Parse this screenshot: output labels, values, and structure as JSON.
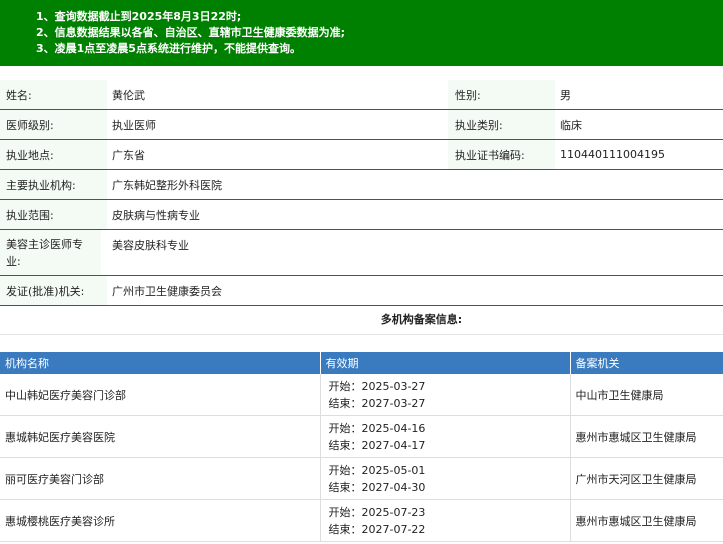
{
  "notice": [
    "1、查询数据截止到2025年8月3日22时;",
    "2、信息数据结果以各省、自治区、直辖市卫生健康委数据为准;",
    "3、凌晨1点至凌晨5点系统进行维护，不能提供查询。"
  ],
  "info": {
    "name_label": "姓名:",
    "name": "黄伦武",
    "gender_label": "性别:",
    "gender": "男",
    "level_label": "医师级别:",
    "level": "执业医师",
    "category_label": "执业类别:",
    "category": "临床",
    "location_label": "执业地点:",
    "location": "广东省",
    "cert_label": "执业证书编码:",
    "cert": "110440111004195",
    "org_label": "主要执业机构:",
    "org": "广东韩妃整形外科医院",
    "scope_label": "执业范围:",
    "scope": "皮肤病与性病专业",
    "cosmetic_label_1": "美容主诊医师专",
    "cosmetic_label_2": "业:",
    "cosmetic": "美容皮肤科专业",
    "issuer_label": "发证(批准)机关:",
    "issuer": "广州市卫生健康委员会"
  },
  "multi": {
    "title": "多机构备案信息:",
    "headers": [
      "机构名称",
      "有效期",
      "备案机关"
    ],
    "start_prefix": "开始：",
    "end_prefix": "结束：",
    "rows": [
      {
        "name": "中山韩妃医疗美容门诊部",
        "start": "2025-03-27",
        "end": "2027-03-27",
        "authority": "中山市卫生健康局"
      },
      {
        "name": "惠城韩妃医疗美容医院",
        "start": "2025-04-16",
        "end": "2027-04-17",
        "authority": "惠州市惠城区卫生健康局"
      },
      {
        "name": "丽可医疗美容门诊部",
        "start": "2025-05-01",
        "end": "2027-04-30",
        "authority": "广州市天河区卫生健康局"
      },
      {
        "name": "惠城樱桃医疗美容诊所",
        "start": "2025-07-23",
        "end": "2027-07-22",
        "authority": "惠州市惠城区卫生健康局"
      }
    ]
  }
}
